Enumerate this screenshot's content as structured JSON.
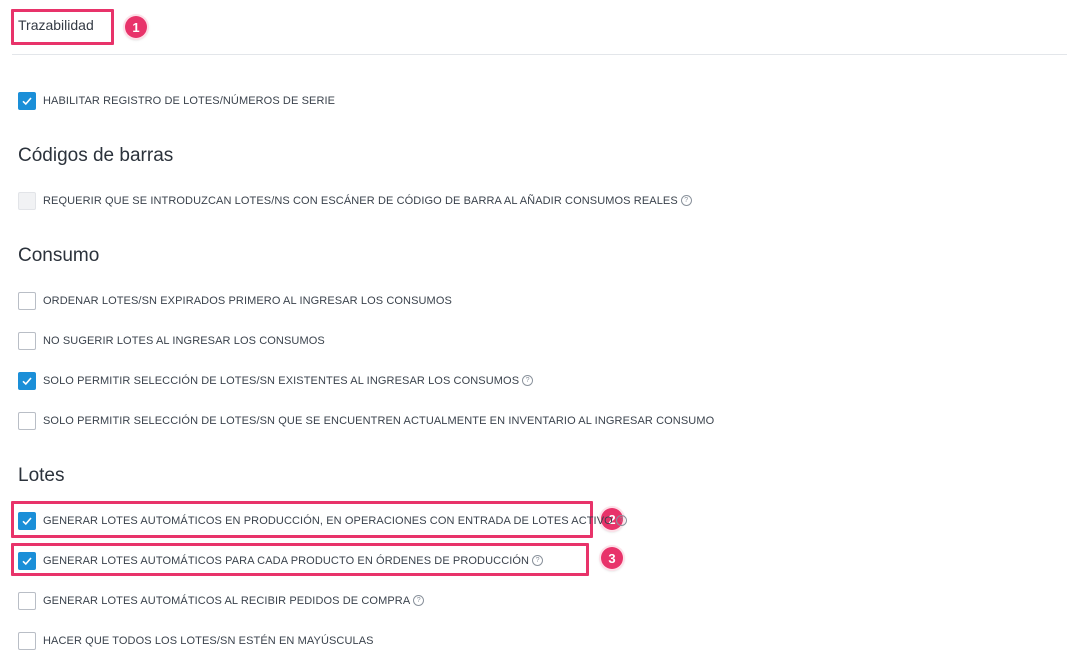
{
  "header": {
    "title": "Trazabilidad"
  },
  "callouts": [
    "1",
    "2",
    "3"
  ],
  "sections": {
    "general": {
      "items": [
        {
          "label": "HABILITAR REGISTRO DE LOTES/NÚMEROS DE SERIE",
          "checked": true
        }
      ]
    },
    "barcodes": {
      "title": "Códigos de barras",
      "items": [
        {
          "label": "REQUERIR QUE SE INTRODUZCAN LOTES/NS CON ESCÁNER DE CÓDIGO DE BARRA AL AÑADIR CONSUMOS REALES",
          "checked": false,
          "disabled": true,
          "help": true
        }
      ]
    },
    "consumption": {
      "title": "Consumo",
      "items": [
        {
          "label": "ORDENAR LOTES/SN EXPIRADOS PRIMERO AL INGRESAR LOS CONSUMOS",
          "checked": false
        },
        {
          "label": "NO SUGERIR LOTES AL INGRESAR LOS CONSUMOS",
          "checked": false
        },
        {
          "label": "SOLO PERMITIR SELECCIÓN DE LOTES/SN EXISTENTES AL INGRESAR LOS CONSUMOS",
          "checked": true,
          "help": true
        },
        {
          "label": "SOLO PERMITIR SELECCIÓN DE LOTES/SN QUE SE ENCUENTREN ACTUALMENTE EN INVENTARIO AL INGRESAR CONSUMO",
          "checked": false
        }
      ]
    },
    "lots": {
      "title": "Lotes",
      "items": [
        {
          "label": "GENERAR LOTES AUTOMÁTICOS EN PRODUCCIÓN, EN OPERACIONES CON ENTRADA DE LOTES ACTIVO",
          "checked": true,
          "help": true
        },
        {
          "label": "GENERAR LOTES AUTOMÁTICOS PARA CADA PRODUCTO EN ÓRDENES DE PRODUCCIÓN",
          "checked": true,
          "help": true
        },
        {
          "label": "GENERAR LOTES AUTOMÁTICOS AL RECIBIR PEDIDOS DE COMPRA",
          "checked": false,
          "help": true
        },
        {
          "label": "HACER QUE TODOS LOS LOTES/SN ESTÉN EN MAYÚSCULAS",
          "checked": false
        }
      ]
    }
  },
  "colors": {
    "accent": "#1b8fd8",
    "highlight": "#e8336a"
  },
  "icons": {
    "check": "check-icon",
    "help": "help-circle-icon"
  }
}
